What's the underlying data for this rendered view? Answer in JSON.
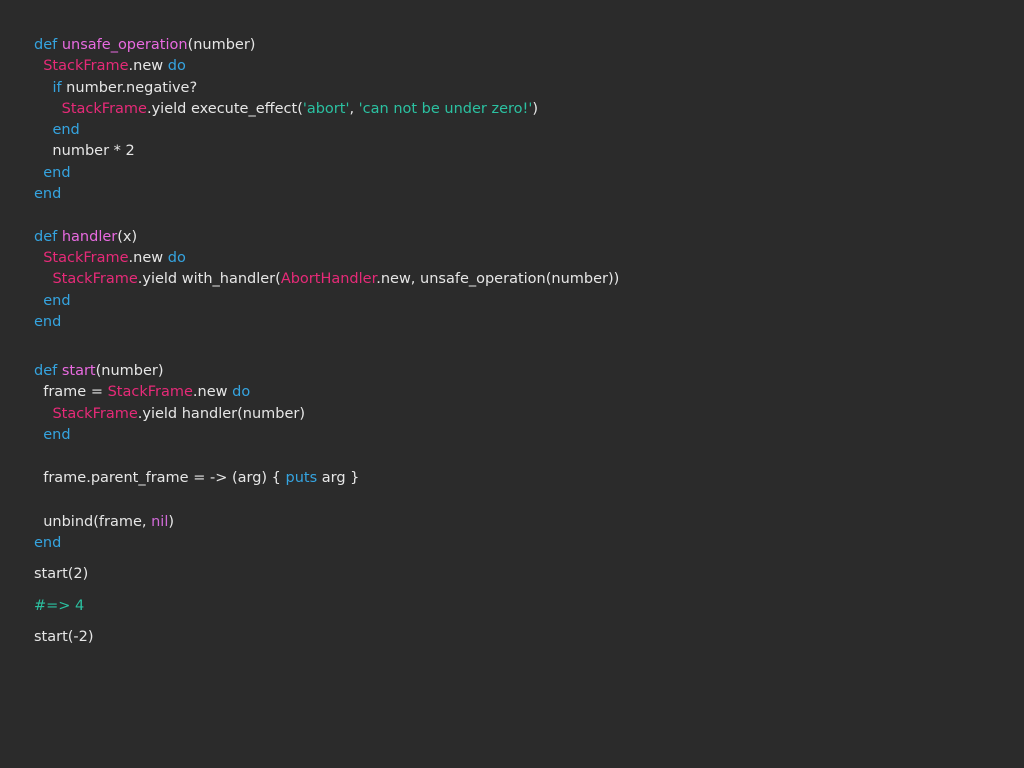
{
  "slide": {
    "lines": [
      [
        "def",
        " ",
        "unsafe_operation",
        "(number)"
      ],
      [
        "  ",
        "StackFrame",
        ".new ",
        "do"
      ],
      [
        "    ",
        "if",
        " number.negative?"
      ],
      [
        "      ",
        "StackFrame",
        ".yield execute_effect(",
        "'abort'",
        ", ",
        "'can not be under zero!'",
        ")"
      ],
      [
        "    ",
        "end"
      ],
      [
        "    number * 2"
      ],
      [
        "  ",
        "end"
      ],
      [
        "end"
      ],
      [
        ""
      ],
      [
        "def",
        " ",
        "handler",
        "(x)"
      ],
      [
        "  ",
        "StackFrame",
        ".new ",
        "do"
      ],
      [
        "    ",
        "StackFrame",
        ".yield with_handler(",
        "AbortHandler",
        ".new, unsafe_operation(number))"
      ],
      [
        "  ",
        "end"
      ],
      [
        "end"
      ],
      [
        ""
      ],
      [
        "def",
        " ",
        "start",
        "(number)"
      ],
      [
        "  frame = ",
        "StackFrame",
        ".new ",
        "do"
      ],
      [
        "    ",
        "StackFrame",
        ".yield handler(number)"
      ],
      [
        "  ",
        "end"
      ],
      [
        ""
      ],
      [
        "  frame.parent_frame = -> (arg) { ",
        "puts",
        " arg }"
      ],
      [
        ""
      ],
      [
        "  unbind(frame, ",
        "nil",
        ")"
      ],
      [
        "end"
      ],
      [
        "start(2)"
      ],
      [
        "#=> 4"
      ],
      [
        "start(-2)"
      ]
    ]
  }
}
